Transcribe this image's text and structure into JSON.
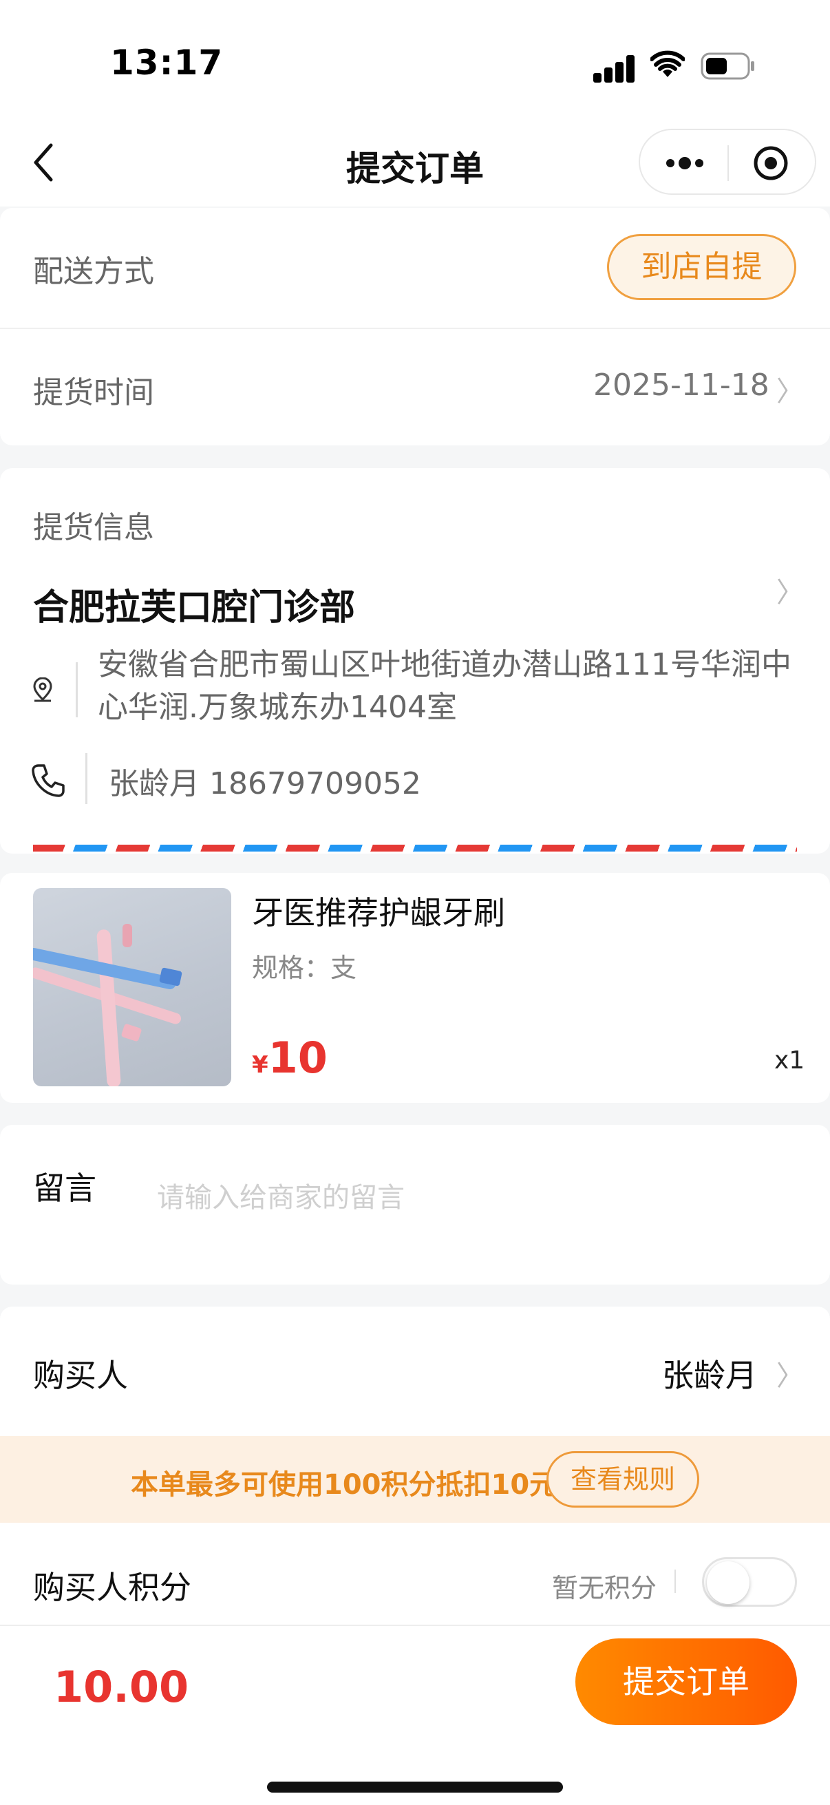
{
  "status_bar": {
    "time": "13:17"
  },
  "nav": {
    "title": "提交订单"
  },
  "delivery": {
    "label": "配送方式",
    "option": "到店自提"
  },
  "pickup_time": {
    "label": "提货时间",
    "value": "2025-11-18"
  },
  "pickup_info": {
    "label": "提货信息",
    "store_name": "合肥拉芙口腔门诊部",
    "address": "安徽省合肥市蜀山区叶地街道办潜山路111号华润中心华润.万象城东办1404室",
    "contact": "张龄月 18679709052"
  },
  "product": {
    "name": "牙医推荐护龈牙刷",
    "spec": "规格：支",
    "currency": "¥",
    "price": "10",
    "quantity": "x1"
  },
  "message": {
    "label": "留言",
    "placeholder": "请输入给商家的留言"
  },
  "buyer": {
    "label": "购买人",
    "value": "张龄月"
  },
  "points_banner": {
    "text": "本单最多可使用100积分抵扣10元",
    "rule_button": "查看规则"
  },
  "buyer_points": {
    "label": "购买人积分",
    "status": "暂无积分"
  },
  "footer": {
    "total": "10.00",
    "submit": "提交订单"
  },
  "colors": {
    "accent_orange": "#ff7a00",
    "price_red": "#e8342f",
    "banner_bg": "#fdf0e2"
  },
  "icons": [
    "back-icon",
    "more-icon",
    "target-icon",
    "location-icon",
    "phone-icon",
    "chevron-right-icon"
  ]
}
